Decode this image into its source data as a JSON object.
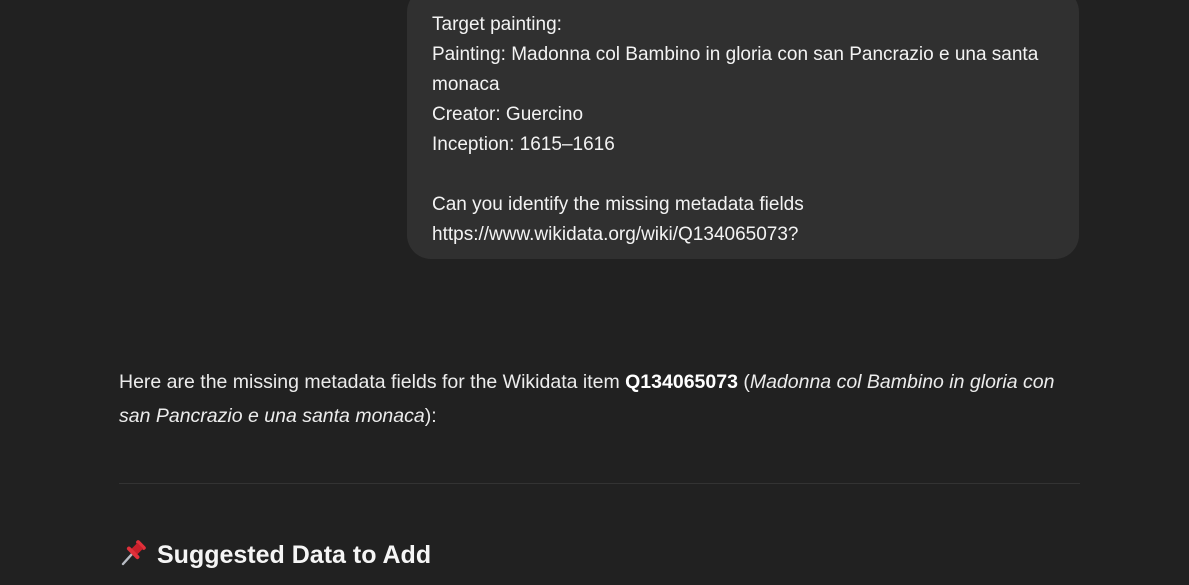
{
  "user_message": {
    "line1": "Target painting:",
    "line2": "Painting: Madonna col Bambino in gloria con san Pancrazio e una santa monaca",
    "line3": "Creator: Guercino",
    "line4": "Inception: 1615–1616",
    "line5": "Can you identify the missing metadata fields",
    "line6": "https://www.wikidata.org/wiki/Q134065073?"
  },
  "assistant_message": {
    "intro_prefix": "Here are the missing metadata fields for the Wikidata item ",
    "item_id": "Q134065073",
    "paren_open": " (",
    "item_title": "Madonna col Bambino in gloria con san Pancrazio e una santa monaca",
    "paren_close": "):",
    "section_icon": "pushpin-icon",
    "section_heading": "Suggested Data to Add"
  }
}
